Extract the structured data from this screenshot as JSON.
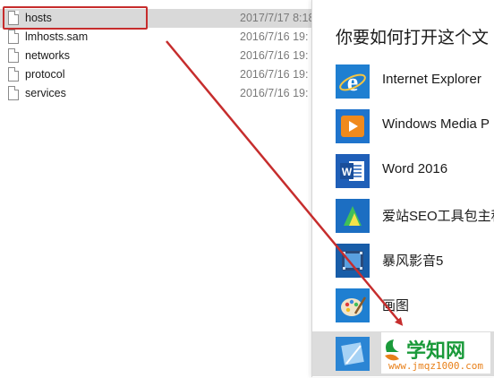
{
  "files": [
    {
      "name": "hosts",
      "date": "2017/7/17 8:18"
    },
    {
      "name": "lmhosts.sam",
      "date": "2016/7/16 19:"
    },
    {
      "name": "networks",
      "date": "2016/7/16 19:"
    },
    {
      "name": "protocol",
      "date": "2016/7/16 19:"
    },
    {
      "name": "services",
      "date": "2016/7/16 19:"
    }
  ],
  "dialog": {
    "title": "你要如何打开这个文",
    "apps": [
      {
        "label": "Internet Explorer",
        "icon": "internet-explorer-icon"
      },
      {
        "label": "Windows Media P",
        "icon": "windows-media-player-icon"
      },
      {
        "label": "Word 2016",
        "icon": "word-icon"
      },
      {
        "label": "爱站SEO工具包主程",
        "icon": "seo-toolkit-icon"
      },
      {
        "label": "暴风影音5",
        "icon": "storm-player-icon"
      },
      {
        "label": "画图",
        "icon": "paint-icon"
      },
      {
        "label": "",
        "icon": "notepad-icon"
      }
    ]
  },
  "watermark": {
    "main": "学知网",
    "url": "www.jmqz1000.com"
  },
  "colors": {
    "highlight": "#c62d2d",
    "selection": "#d9d9d9",
    "watermark_green": "#1a9a3a",
    "watermark_orange": "#e8801a"
  }
}
